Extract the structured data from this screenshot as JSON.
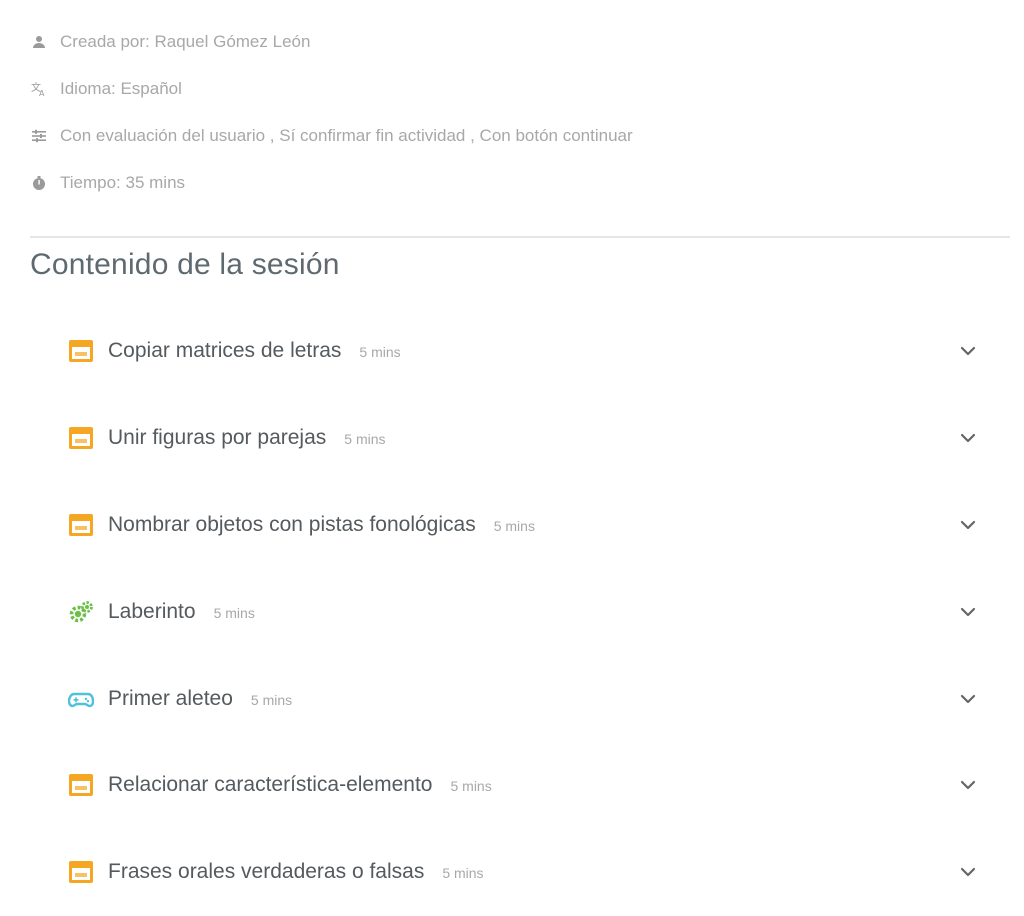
{
  "meta": {
    "creator": "Creada por: Raquel Gómez León",
    "language": "Idioma: Español",
    "settings": "Con evaluación del usuario , Sí confirmar fin actividad , Con botón continuar",
    "time": "Tiempo: 35 mins",
    "icons": [
      "user-icon",
      "translate-icon",
      "settings-list-icon",
      "timer-icon"
    ]
  },
  "section": {
    "title": "Contenido de la sesión"
  },
  "colors": {
    "orange": "#f5a623",
    "green": "#6cc04a",
    "cyan": "#4ec1dd",
    "text": "#555a5e",
    "muted": "#a8a8a8"
  },
  "activities": [
    {
      "title": "Copiar matrices de letras",
      "duration": "5 mins",
      "icon": "calendar-icon"
    },
    {
      "title": "Unir figuras por parejas",
      "duration": "5 mins",
      "icon": "calendar-icon"
    },
    {
      "title": "Nombrar objetos con pistas fonológicas",
      "duration": "5 mins",
      "icon": "calendar-icon"
    },
    {
      "title": "Laberinto",
      "duration": "5 mins",
      "icon": "gears-icon"
    },
    {
      "title": "Primer aleteo",
      "duration": "5 mins",
      "icon": "gamepad-icon"
    },
    {
      "title": "Relacionar característica-elemento",
      "duration": "5 mins",
      "icon": "calendar-icon"
    },
    {
      "title": "Frases orales verdaderas o falsas",
      "duration": "5 mins",
      "icon": "calendar-icon"
    }
  ]
}
